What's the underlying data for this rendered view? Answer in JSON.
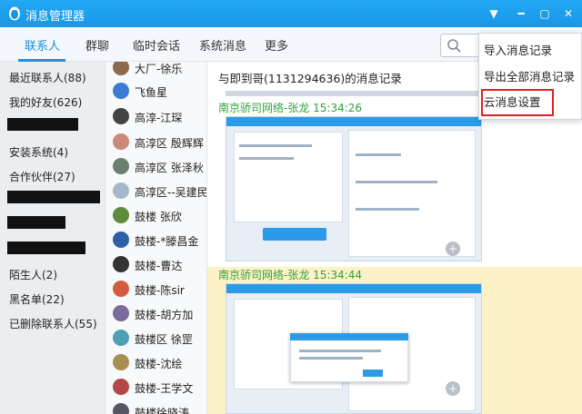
{
  "window": {
    "title": "消息管理器"
  },
  "tabs": [
    "联系人",
    "群聊",
    "临时会话",
    "系统消息",
    "更多"
  ],
  "groups": [
    "最近联系人(88)",
    "我的好友(626)",
    "安装系统(4)",
    "合作伙伴(27)",
    "陌生人(2)",
    "黑名单(22)",
    "已删除联系人(55)"
  ],
  "friends": [
    "大厂-徐乐",
    "飞鱼星",
    "高淳-江琛",
    "高淳区 殷辉辉",
    "高淳区 张泽秋",
    "高淳区--吴建民",
    "鼓楼 张欣",
    "鼓楼-*滕昌金",
    "鼓楼-曹达",
    "鼓楼-陈sir",
    "鼓楼-胡方加",
    "鼓楼区 徐罡",
    "鼓楼-沈绘",
    "鼓楼-王学文",
    "鼓楼徐晓涛"
  ],
  "record": {
    "title": "与即到哥(1131294636)的消息记录",
    "messages": [
      {
        "sender": "南京骄司网络-张龙",
        "time": "15:34:26"
      },
      {
        "sender": "南京骄司网络-张龙",
        "time": "15:34:44"
      }
    ]
  },
  "menu": {
    "items": [
      "导入消息记录",
      "导出全部消息记录",
      "云消息设置"
    ],
    "highlighted": "云消息设置"
  },
  "colors": {
    "titlebar": "#1da1f2",
    "accent": "#1a8fe0",
    "sender": "#2ea43b",
    "highlight_box": "#e02020"
  }
}
